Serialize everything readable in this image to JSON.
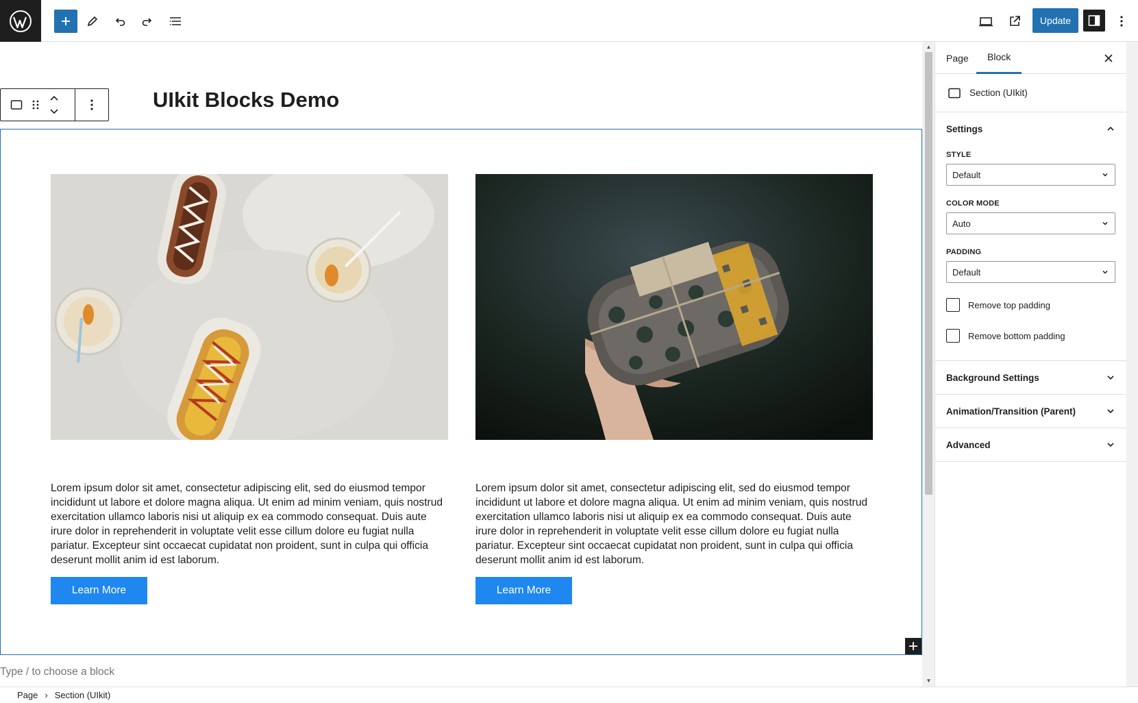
{
  "toolbar": {
    "update_label": "Update"
  },
  "editor": {
    "page_title": "UIkit Blocks Demo",
    "columns": [
      {
        "image_alt": "Two hot dogs and iced drinks on a white table",
        "text": "Lorem ipsum dolor sit amet, consectetur adipiscing elit, sed do eiusmod tempor incididunt ut labore et dolore magna aliqua. Ut enim ad minim veniam, quis nostrud exercitation ullamco laboris nisi ut aliquip ex ea commodo consequat. Duis aute irure dolor in reprehenderit in voluptate velit esse cillum dolore eu fugiat nulla pariatur. Excepteur sint occaecat cupidatat non proident, sunt in culpa qui officia deserunt mollit anim id est laborum.",
        "button_label": "Learn More"
      },
      {
        "image_alt": "Hand holding folded wool socks tied with twine",
        "text": "Lorem ipsum dolor sit amet, consectetur adipiscing elit, sed do eiusmod tempor incididunt ut labore et dolore magna aliqua. Ut enim ad minim veniam, quis nostrud exercitation ullamco laboris nisi ut aliquip ex ea commodo consequat. Duis aute irure dolor in reprehenderit in voluptate velit esse cillum dolore eu fugiat nulla pariatur. Excepteur sint occaecat cupidatat non proident, sunt in culpa qui officia deserunt mollit anim id est laborum.",
        "button_label": "Learn More"
      }
    ],
    "placeholder": "Type / to choose a block"
  },
  "breadcrumb": {
    "items": [
      "Page",
      "Section (UIkit)"
    ]
  },
  "sidebar": {
    "tabs": [
      "Page",
      "Block"
    ],
    "active_tab": "Block",
    "block_name": "Section (UIkit)",
    "settings": {
      "title": "Settings",
      "style_label": "STYLE",
      "style_value": "Default",
      "color_mode_label": "COLOR MODE",
      "color_mode_value": "Auto",
      "padding_label": "PADDING",
      "padding_value": "Default",
      "remove_top_padding": "Remove top padding",
      "remove_bottom_padding": "Remove bottom padding"
    },
    "panels": [
      "Background Settings",
      "Animation/Transition (Parent)",
      "Advanced"
    ]
  },
  "colors": {
    "accent": "#2271b1",
    "button": "#1e87f0",
    "dark": "#1e1e1e"
  }
}
